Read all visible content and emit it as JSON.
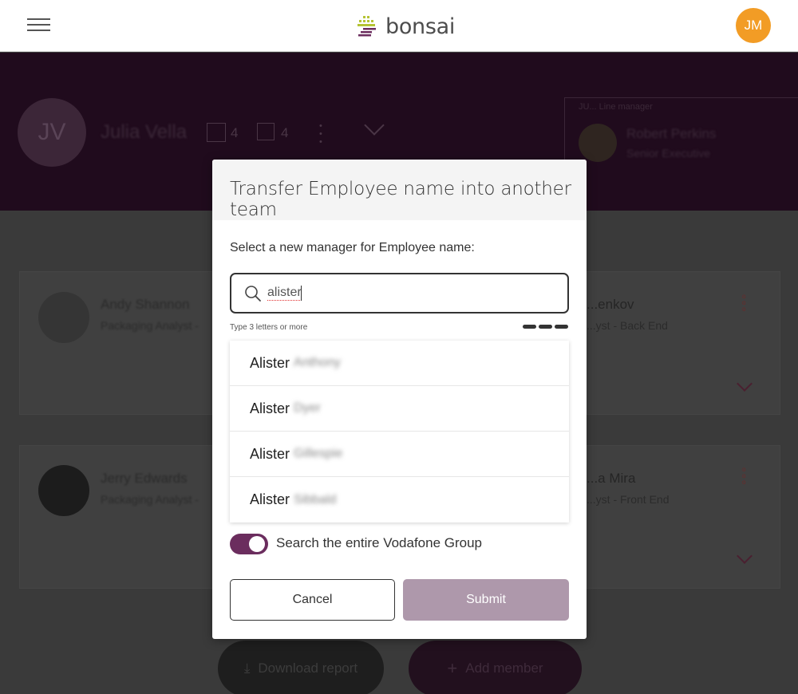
{
  "topbar": {
    "logo_text": "bonsai",
    "avatar_initials": "JM",
    "avatar_color": "#f29c25"
  },
  "background": {
    "profile_initials": "JV",
    "profile_name": "Julia Vella",
    "direct_count": "4",
    "team_count": "4",
    "manager_label": "JU... Line manager",
    "manager_name": "Robert Perkins",
    "manager_role": "Senior Executive",
    "cards": [
      {
        "name": "Andy Shannon",
        "role": "Packaging Analyst -"
      },
      {
        "name": "...enkov",
        "role": "...yst - Back End"
      },
      {
        "name": "Jerry Edwards",
        "role": "Packaging Analyst -"
      },
      {
        "name": "...a Mira",
        "role": "...yst - Front End"
      }
    ],
    "download_label": "Download report",
    "add_member_label": "Add member"
  },
  "modal": {
    "title": "Transfer Employee name into another team",
    "prompt": "Select a new manager for Employee name:",
    "search": {
      "value": "alister",
      "hint": "Type 3 letters or more"
    },
    "results": [
      {
        "first": "Alister",
        "last": "Anthony"
      },
      {
        "first": "Alister",
        "last": "Dyer"
      },
      {
        "first": "Alister",
        "last": "Gillespie"
      },
      {
        "first": "Alister",
        "last": "Sibbald"
      }
    ],
    "toggle": {
      "label": "Search the entire Vodafone Group",
      "on": true,
      "color": "#6b2d5e"
    },
    "cancel_label": "Cancel",
    "submit_label": "Submit",
    "submit_color": "#ae98ab"
  }
}
